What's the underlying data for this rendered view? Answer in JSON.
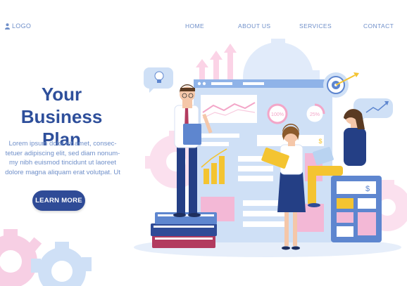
{
  "header": {
    "logo": "LOGO",
    "nav": [
      "HOME",
      "ABOUT US",
      "SERVICES",
      "CONTACT"
    ]
  },
  "hero": {
    "title_line1": "Your Business",
    "title_line2": "Plan",
    "body_lines": [
      "Lorem ipsum dolor sit amet, consec-",
      "tetuer adipiscing elit, sed diam nonum-",
      "my nibh euismod tincidunt ut laoreet",
      "dolore magna aliquam erat volutpat. Ut"
    ],
    "cta": "LEARN MORE"
  },
  "illustration": {
    "progress_1": "100%",
    "progress_2": "25%",
    "currency_1": "$",
    "currency_2": "$"
  },
  "colors": {
    "brand_dark": "#2e4f9b",
    "nav_text": "#6f8fc9",
    "button": "#2f4b97",
    "light_blue": "#b9d3f1",
    "pink": "#f3b8d6",
    "yellow": "#f4c431"
  },
  "icons": [
    "user-icon",
    "lightbulb-icon",
    "target-icon",
    "growth-chart-icon",
    "gear-icon",
    "dollar-icon",
    "arrow-up-icon"
  ]
}
